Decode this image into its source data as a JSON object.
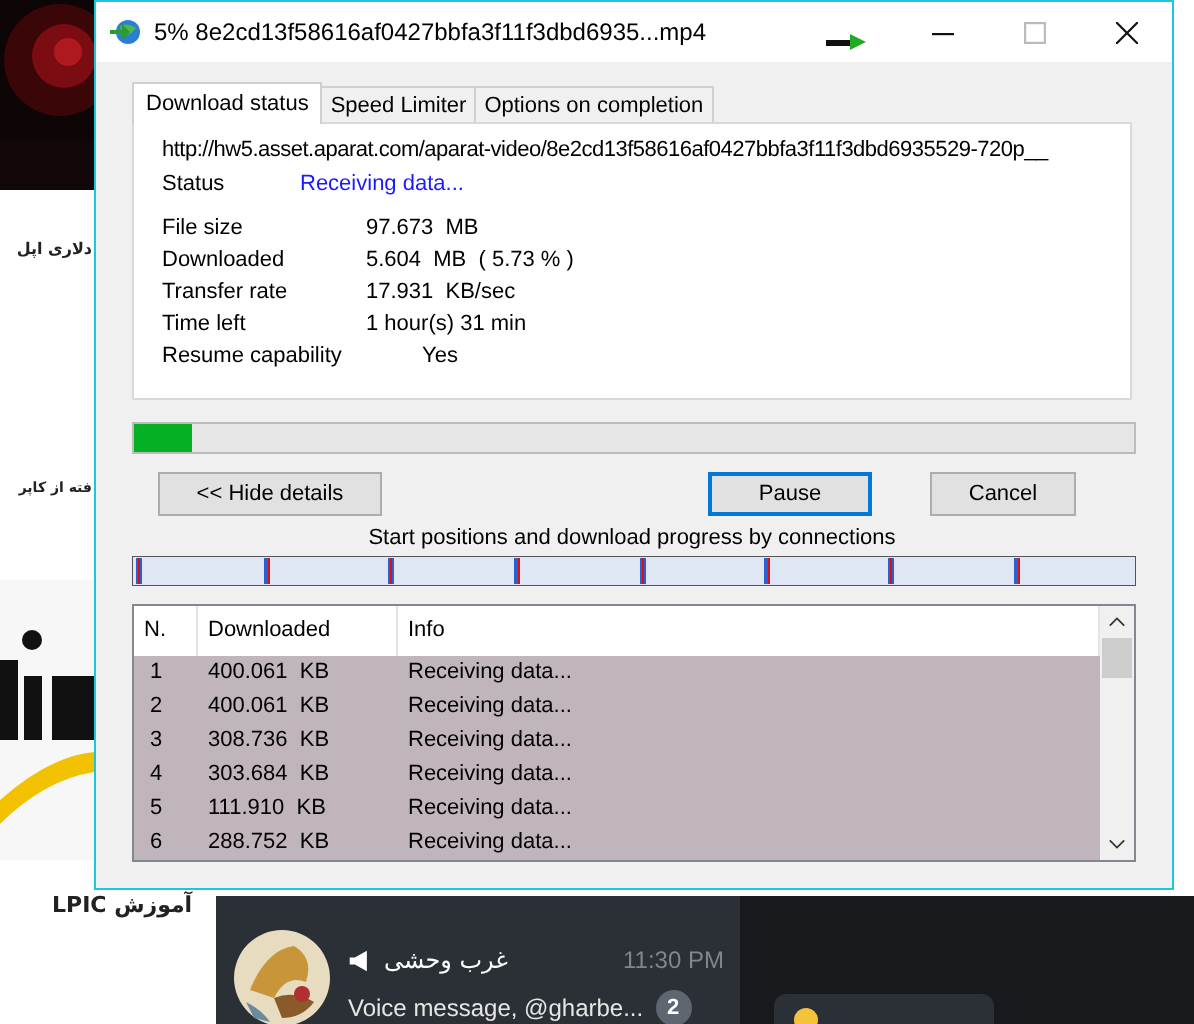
{
  "background": {
    "page_texts": [
      {
        "text": "دلاری اپل"
      },
      {
        "text": "فته از کاپر"
      },
      {
        "text": "آموزش LPIC"
      }
    ],
    "chat": {
      "name": "غرب وحشی",
      "time": "11:30 PM",
      "message": "Voice message, @gharbe...",
      "unread": "2"
    }
  },
  "window": {
    "title": "5% 8e2cd13f58616af0427bbfa3f11f3dbd6935...mp4"
  },
  "tabs": [
    {
      "label": "Download status",
      "selected": true
    },
    {
      "label": "Speed Limiter",
      "selected": false
    },
    {
      "label": "Options on completion",
      "selected": false
    }
  ],
  "url": "http://hw5.asset.aparat.com/aparat-video/8e2cd13f58616af0427bbfa3f11f3dbd6935529-720p__",
  "status": {
    "label": "Status",
    "value": "Receiving data..."
  },
  "details": [
    {
      "label": "File size",
      "value": "97.673  MB"
    },
    {
      "label": "Downloaded",
      "value": "5.604  MB  ( 5.73 % )"
    },
    {
      "label": "Transfer rate",
      "value": "17.931  KB/sec"
    },
    {
      "label": "Time left",
      "value": "1 hour(s) 31 min"
    },
    {
      "label": "Resume capability",
      "value": "Yes",
      "kind": "indented"
    }
  ],
  "progress": {
    "level": 0.0573
  },
  "buttons": [
    {
      "label": "<< Hide details",
      "focused": false
    },
    {
      "label": "Pause",
      "focused": true
    },
    {
      "label": "Cancel",
      "focused": false
    }
  ],
  "connections_caption": "Start positions and download progress by connections",
  "table": {
    "columns": [
      "N.",
      "Downloaded",
      "Info"
    ],
    "rows": [
      {
        "cells": [
          "1",
          "400.061  KB",
          "Receiving data..."
        ],
        "selected": true
      },
      {
        "cells": [
          "2",
          "400.061  KB",
          "Receiving data..."
        ],
        "selected": true
      },
      {
        "cells": [
          "3",
          "308.736  KB",
          "Receiving data..."
        ],
        "selected": true
      },
      {
        "cells": [
          "4",
          "303.684  KB",
          "Receiving data..."
        ],
        "selected": true
      },
      {
        "cells": [
          "5",
          "111.910  KB",
          "Receiving data..."
        ],
        "selected": true
      },
      {
        "cells": [
          "6",
          "288.752  KB",
          "Receiving data..."
        ],
        "selected": true
      }
    ]
  }
}
